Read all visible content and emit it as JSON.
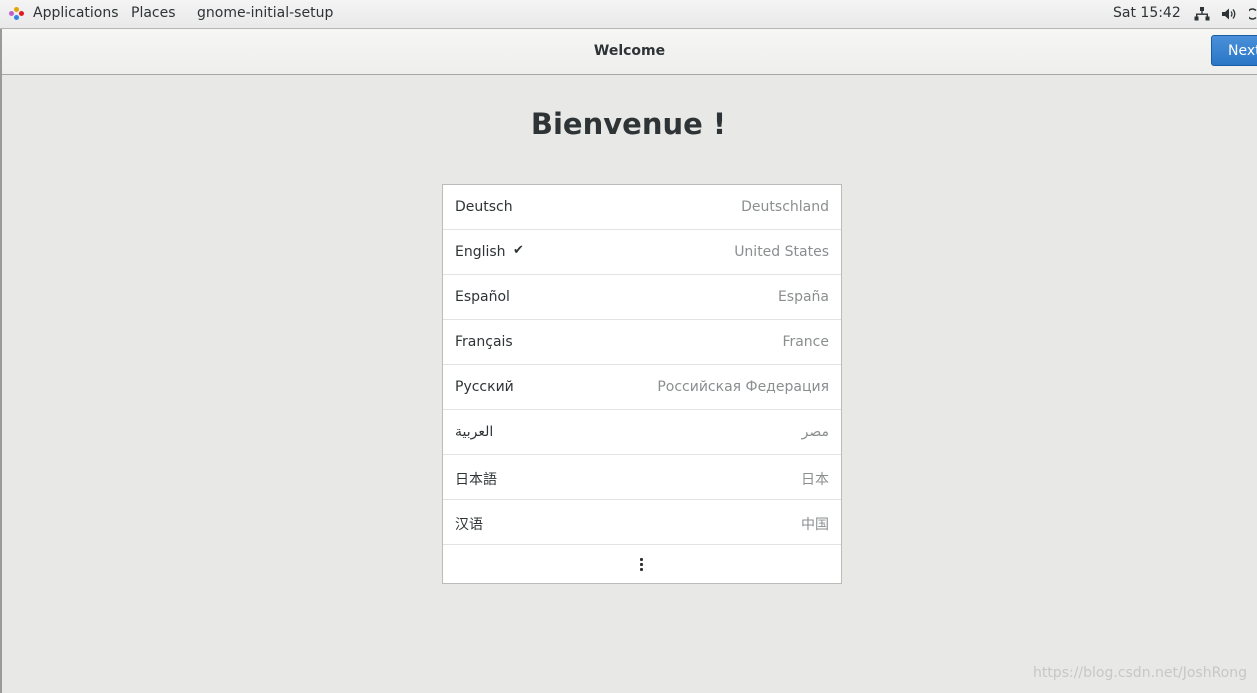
{
  "topbar": {
    "applications": "Applications",
    "places": "Places",
    "app_name": "gnome-initial-setup",
    "clock": "Sat 15:42"
  },
  "header": {
    "title": "Welcome",
    "next_label": "Next"
  },
  "heading": "Bienvenue !",
  "languages": [
    {
      "language": "Deutsch",
      "region": "Deutschland"
    },
    {
      "language": "English",
      "region": "United States"
    },
    {
      "language": "Español",
      "region": "España"
    },
    {
      "language": "Français",
      "region": "France"
    },
    {
      "language": "Русский",
      "region": "Российская Федерация"
    },
    {
      "language": "العربية",
      "region": "مصر"
    },
    {
      "language": "日本語",
      "region": "日本"
    },
    {
      "language": "汉语",
      "region": "中国"
    }
  ],
  "selected_language": "English",
  "watermark": "https://blog.csdn.net/JoshRong",
  "colors": {
    "accent": "#2a76c6",
    "background": "#e8e8e7"
  }
}
